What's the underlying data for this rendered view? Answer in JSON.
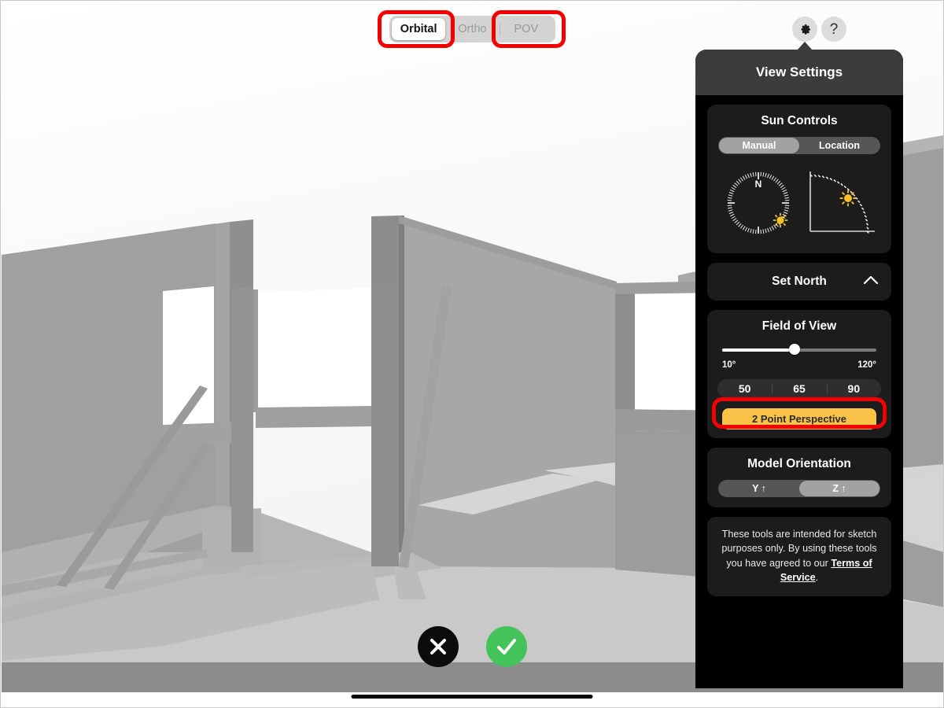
{
  "camera_modes": {
    "name": "camera-mode-switcher",
    "options": [
      {
        "label": "Orbital",
        "selected": true
      },
      {
        "label": "Ortho",
        "selected": false
      },
      {
        "label": "POV",
        "selected": false
      }
    ]
  },
  "toolbar_icons": {
    "gear": "gear-icon",
    "help_label": "?"
  },
  "panel": {
    "title": "View Settings",
    "sun_controls": {
      "title": "Sun Controls",
      "mode_options": [
        {
          "label": "Manual",
          "selected": true
        },
        {
          "label": "Location",
          "selected": false
        }
      ],
      "azimuth_dial": {
        "name": "sun-azimuth-compass",
        "north_label": "N",
        "sun_azimuth_deg": 133
      },
      "elevation_dial": {
        "name": "sun-elevation-dial",
        "sun_elevation_deg": 42
      }
    },
    "set_north": {
      "label": "Set North",
      "chevron": "chevron-up-icon"
    },
    "field_of_view": {
      "title": "Field of View",
      "slider": {
        "value": 65,
        "min": 10,
        "max": 120,
        "min_label": "10°",
        "max_label": "120°",
        "fill_percent": 47
      },
      "presets": [
        {
          "label": "50",
          "selected": false
        },
        {
          "label": "65",
          "selected": false
        },
        {
          "label": "90",
          "selected": false
        }
      ],
      "perspective_button": {
        "label": "2 Point Perspective",
        "active": true,
        "color": "#fbc council"
      }
    },
    "model_orientation": {
      "title": "Model Orientation",
      "options": [
        {
          "label": "Y ↑",
          "selected": false
        },
        {
          "label": "Z ↑",
          "selected": true
        }
      ]
    },
    "disclaimer": {
      "text_before": "These tools are intended for sketch purposes only. By using these tools you have agreed to our ",
      "link_text": "Terms of Service",
      "text_after": "."
    }
  },
  "actions": {
    "cancel": {
      "name": "cancel-button",
      "glyph": "✕"
    },
    "accept": {
      "name": "accept-button",
      "glyph": "✓"
    }
  },
  "annotations": {
    "highlight_color": "#f20000",
    "highlighted": [
      "Orbital",
      "POV",
      "2 Point Perspective"
    ]
  },
  "colors": {
    "panel_bg": "#000000",
    "card_bg": "#1c1c1c",
    "header_bg": "#3c3c3c",
    "accent_amber": "#fbc council",
    "accept_green": "#43c35a",
    "annotation_red": "#f20000",
    "sun_yellow": "#f5c02a"
  }
}
